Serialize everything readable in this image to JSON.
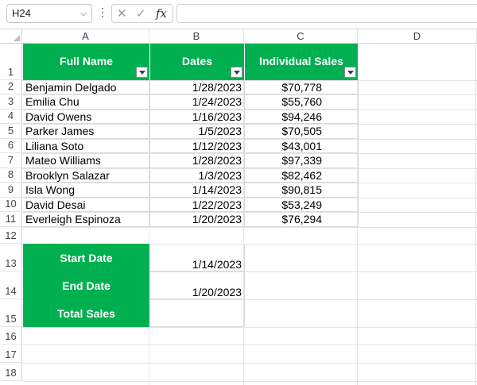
{
  "formula_bar": {
    "name_box": "H24",
    "formula": "",
    "cancel_icon": "x-icon",
    "enter_icon": "check-icon",
    "function_label": "fx"
  },
  "columns": [
    "A",
    "B",
    "C",
    "D"
  ],
  "rows": [
    "1",
    "2",
    "3",
    "4",
    "5",
    "6",
    "7",
    "8",
    "9",
    "10",
    "11",
    "12",
    "13",
    "14",
    "15",
    "16",
    "17",
    "18"
  ],
  "table": {
    "headers": [
      "Full Name",
      "Dates",
      "Individual Sales"
    ],
    "rows": [
      {
        "name": "Benjamin Delgado",
        "date": "1/28/2023",
        "sales": "$70,778"
      },
      {
        "name": "Emilia Chu",
        "date": "1/24/2023",
        "sales": "$55,760"
      },
      {
        "name": "David Owens",
        "date": "1/16/2023",
        "sales": "$94,246"
      },
      {
        "name": "Parker James",
        "date": "1/5/2023",
        "sales": "$70,505"
      },
      {
        "name": "Liliana Soto",
        "date": "1/12/2023",
        "sales": "$43,001"
      },
      {
        "name": "Mateo Williams",
        "date": "1/28/2023",
        "sales": "$97,339"
      },
      {
        "name": "Brooklyn Salazar",
        "date": "1/3/2023",
        "sales": "$82,462"
      },
      {
        "name": "Isla Wong",
        "date": "1/14/2023",
        "sales": "$90,815"
      },
      {
        "name": "David Desai",
        "date": "1/22/2023",
        "sales": "$53,249"
      },
      {
        "name": "Everleigh Espinoza",
        "date": "1/20/2023",
        "sales": "$76,294"
      }
    ]
  },
  "summary": {
    "start_label": "Start Date",
    "start_value": "1/14/2023",
    "end_label": "End Date",
    "end_value": "1/20/2023",
    "total_label": "Total Sales",
    "total_value": ""
  },
  "colors": {
    "header_green": "#00b050",
    "grid": "#e3e3e3"
  }
}
